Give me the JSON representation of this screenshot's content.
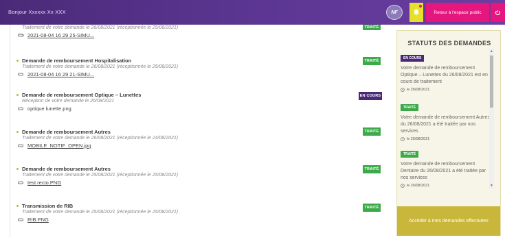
{
  "header": {
    "greeting": "Bonjour Xxxxxx Xx XXX",
    "logo_text": "NF",
    "back_label": "Retour à l'espace public"
  },
  "requests": [
    {
      "title": "",
      "subtitle": "Traitement de votre demande le 26/08/2021 (réceptionnée le 25/08/2021)",
      "file": "2021-08-04 16 29 25-SIMU...",
      "status": "TRAITÉ"
    },
    {
      "title": "Demande de remboursement Hospitalisation",
      "subtitle": "Traitement de votre demande le 26/08/2021 (réceptionnée le 25/08/2021)",
      "file": "2021-08-04 16 29 21-SIMU...",
      "status": "TRAITÉ"
    },
    {
      "title": "Demande de remboursement Optique – Lunettes",
      "subtitle": "Réception de votre demande le 26/08/2021",
      "file": "optique lunette.png",
      "status": "EN COURS"
    },
    {
      "title": "Demande de remboursement Autres",
      "subtitle": "Traitement de votre demande le 26/08/2021 (réceptionnée le 24/08/2021)",
      "file": "MOBILE_NOTIF_OPEN.jpg",
      "status": "TRAITÉ"
    },
    {
      "title": "Demande de remboursement Autres",
      "subtitle": "Traitement de votre demande le 25/08/2021 (réceptionnée le 25/08/2021)",
      "file": "test recto.PNG",
      "status": "TRAITÉ"
    },
    {
      "title": "Transmission de RIB",
      "subtitle": "Traitement de votre demande le 25/08/2021 (réceptionnée le 25/08/2021)",
      "file": "RIB.PNG",
      "status": "TRAITÉ"
    }
  ],
  "panel": {
    "title": "STATUTS DES DEMANDES",
    "notifications": [
      {
        "status": "EN COURS",
        "text": "Votre demande de remboursement Optique – Lunettes du 26/08/2021 est en cours de traitement",
        "date": "le 26/08/2021"
      },
      {
        "status": "TRAITÉ",
        "text": "Votre demande de remboursement Autres du 26/08/2021 a été traitée par nos services",
        "date": "le 26/08/2021"
      },
      {
        "status": "TRAITÉ",
        "text": "Votre demande de remboursement Dentaire du 26/08/2021 a été traitée par nos services",
        "date": "le 26/08/2021"
      }
    ],
    "footer": "Accéder à mes demandes effectuées"
  },
  "colors": {
    "header": "#4a2a78",
    "accent_pink": "#e5177e",
    "bell_yellow": "#e6e02a",
    "badge_done": "#3daa4a",
    "badge_pending": "#4a2a78",
    "panel_footer": "#c8b73a"
  },
  "icons": {
    "bell": "bell-icon",
    "logout": "power-icon",
    "attachment": "paperclip-icon",
    "date": "clock-icon"
  }
}
